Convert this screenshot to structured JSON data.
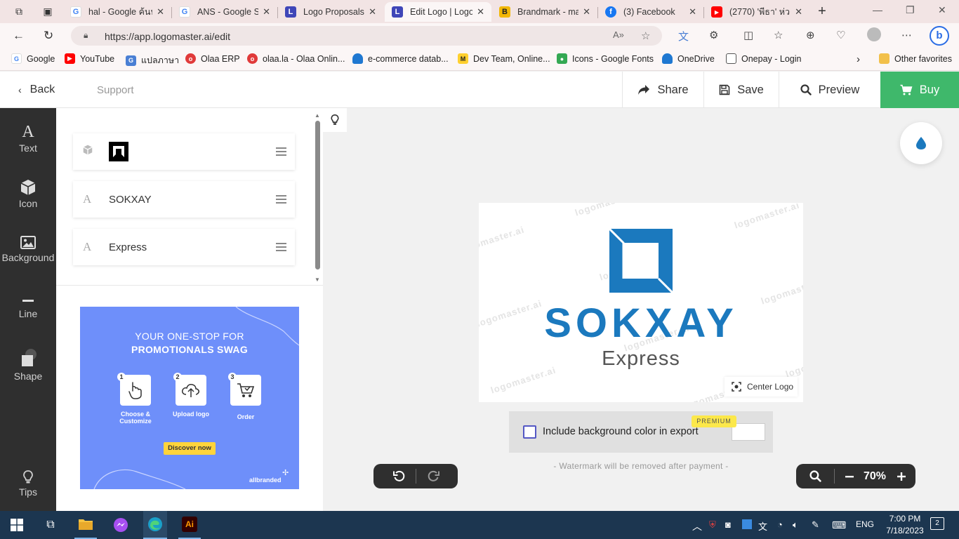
{
  "browser": {
    "tabs": [
      {
        "title": "hal - Google ค้นห",
        "favicon": "google-icon"
      },
      {
        "title": "ANS - Google Se",
        "favicon": "google-icon"
      },
      {
        "title": "Logo Proposals",
        "favicon": "logomaster-icon"
      },
      {
        "title": "Edit Logo | Logo",
        "favicon": "logomaster-icon",
        "active": true
      },
      {
        "title": "Brandmark - ma",
        "favicon": "brandmark-icon"
      },
      {
        "title": "(3) Facebook",
        "favicon": "facebook-icon"
      },
      {
        "title": "(2770) 'พีธา' ห่วง",
        "favicon": "youtube-icon"
      }
    ],
    "url": "https://app.logomaster.ai/edit",
    "bookmarks": [
      {
        "label": "Google",
        "icon": "google-icon"
      },
      {
        "label": "YouTube",
        "icon": "youtube-icon"
      },
      {
        "label": "แปลภาษา",
        "icon": "translate-icon"
      },
      {
        "label": "Olaa ERP",
        "icon": "olaa-icon"
      },
      {
        "label": "olaa.la - Olaa Onlin...",
        "icon": "olaa-icon"
      },
      {
        "label": "e-commerce datab...",
        "icon": "onedrive-icon"
      },
      {
        "label": "Dev Team, Online...",
        "icon": "miro-icon"
      },
      {
        "label": "Icons - Google Fonts",
        "icon": "google-fonts-icon"
      },
      {
        "label": "OneDrive",
        "icon": "onedrive-icon"
      },
      {
        "label": "Onepay - Login",
        "icon": "page-icon"
      }
    ],
    "other_favorites": "Other favorites"
  },
  "appbar": {
    "back": "Back",
    "support": "Support",
    "share": "Share",
    "save": "Save",
    "preview": "Preview",
    "buy": "Buy",
    "buy_color": "#3fb86b"
  },
  "sidebar": {
    "items": [
      {
        "label": "Text",
        "icon": "text-icon"
      },
      {
        "label": "Icon",
        "icon": "cube-icon"
      },
      {
        "label": "Background",
        "icon": "image-icon"
      },
      {
        "label": "Line",
        "icon": "line-icon"
      },
      {
        "label": "Shape",
        "icon": "shape-icon"
      },
      {
        "label": "Tips",
        "icon": "bulb-icon"
      }
    ]
  },
  "layers": [
    {
      "type": "icon",
      "name": ""
    },
    {
      "type": "text",
      "name": "SOKXAY"
    },
    {
      "type": "text",
      "name": "Express"
    }
  ],
  "promo": {
    "line1": "YOUR ONE-STOP FOR",
    "line2": "PROMOTIONALS SWAG",
    "steps": [
      {
        "num": "1",
        "label": "Choose & Customize"
      },
      {
        "num": "2",
        "label": "Upload logo"
      },
      {
        "num": "3",
        "label": "Order"
      }
    ],
    "cta": "Discover now",
    "brand": "allbranded"
  },
  "logo": {
    "title": "SOKXAY",
    "subtitle": "Express",
    "watermark": "logomaster.ai",
    "primary_color": "#1b79be"
  },
  "canvas": {
    "center_logo": "Center Logo",
    "include_bg": "Include background color in export",
    "premium": "PREMIUM",
    "watermark_note": "- Watermark will be removed after payment -",
    "zoom": "70%"
  },
  "taskbar": {
    "lang": "ENG",
    "time": "7:00 PM",
    "date": "7/18/2023",
    "notifications": "2"
  }
}
